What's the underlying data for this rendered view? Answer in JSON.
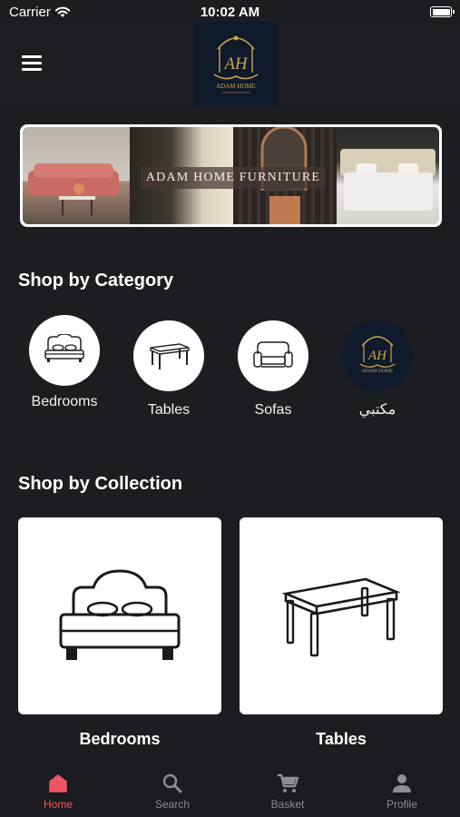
{
  "status_bar": {
    "carrier": "Carrier",
    "time": "10:02 AM"
  },
  "header": {
    "logo": {
      "monogram": "AH",
      "name": "ADAM HOME"
    }
  },
  "banner": {
    "title": "ADAM HOME FURNITURE"
  },
  "sections": {
    "category_title": "Shop by Category",
    "collection_title": "Shop by Collection"
  },
  "categories": [
    {
      "label": "Bedrooms",
      "icon": "bed-icon"
    },
    {
      "label": "Tables",
      "icon": "table-icon"
    },
    {
      "label": "Sofas",
      "icon": "sofa-icon"
    },
    {
      "label": "مكتبي",
      "icon": "adam-home-logo"
    }
  ],
  "collections": [
    {
      "label": "Bedrooms",
      "icon": "bed-icon"
    },
    {
      "label": "Tables",
      "icon": "table-icon"
    }
  ],
  "tabs": [
    {
      "label": "Home",
      "icon": "home-icon",
      "active": true
    },
    {
      "label": "Search",
      "icon": "search-icon",
      "active": false
    },
    {
      "label": "Basket",
      "icon": "cart-icon",
      "active": false
    },
    {
      "label": "Profile",
      "icon": "person-icon",
      "active": false
    }
  ],
  "colors": {
    "accent": "#ef5563",
    "background": "#1c1d20",
    "inactive": "#8d8d92",
    "gold": "#c9a44a"
  }
}
